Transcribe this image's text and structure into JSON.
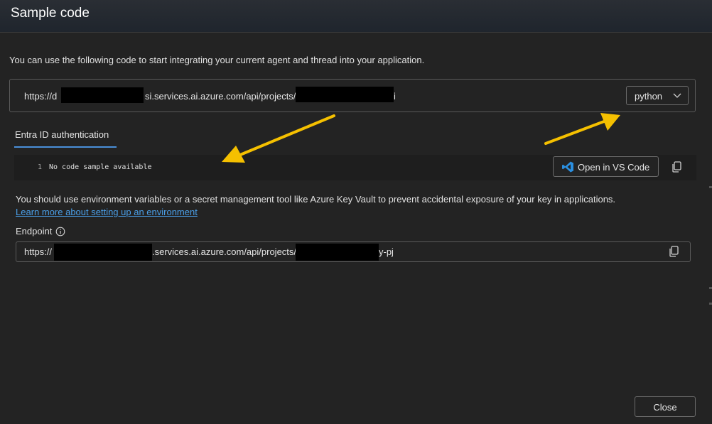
{
  "dialog": {
    "title": "Sample code",
    "description": "You can use the following code to start integrating your current agent and thread into your application."
  },
  "url_bar": {
    "prefix": "https://d",
    "middle": "si.services.ai.azure.com/api/projects/",
    "suffix": "i"
  },
  "language_select": {
    "selected": "python",
    "icon": "chevron-down-icon"
  },
  "tabs": [
    {
      "label": "Entra ID authentication",
      "active": true
    }
  ],
  "code": {
    "line_number": "1",
    "text": "No code sample available"
  },
  "vscode_button": {
    "label": "Open in VS Code",
    "icon": "vscode-icon",
    "accent": "#2b8fe0"
  },
  "warning": {
    "text": "You should use environment variables or a secret management tool like Azure Key Vault to prevent accidental exposure of your key in applications.",
    "link": "Learn more about setting up an environment"
  },
  "endpoint": {
    "label": "Endpoint",
    "prefix": "https://",
    "middle": ".services.ai.azure.com/api/projects/",
    "suffix": "y-pj"
  },
  "footer": {
    "close_label": "Close"
  },
  "colors": {
    "background": "#232323",
    "accent_link": "#4a9fe8",
    "tab_underline": "#4a90d9",
    "annotation_arrow": "#f5c000"
  }
}
